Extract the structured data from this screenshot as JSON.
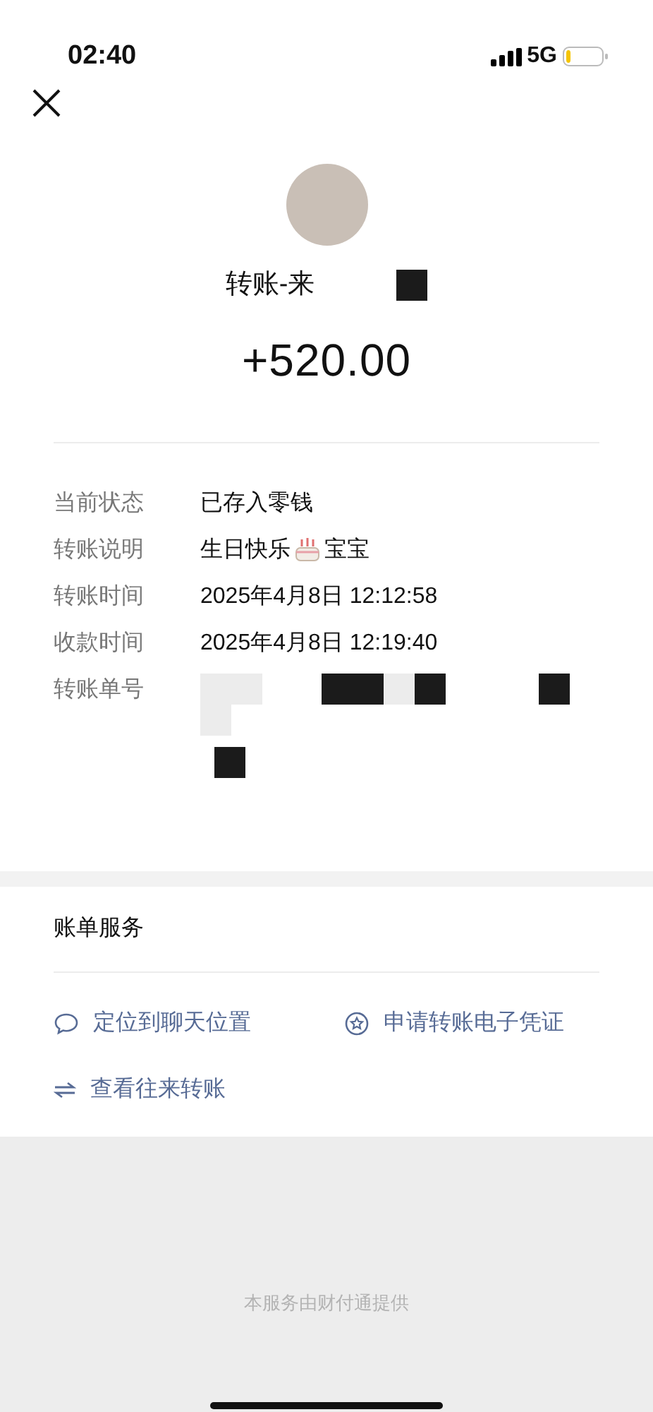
{
  "status_bar": {
    "time": "02:40",
    "network": "5G"
  },
  "header": {
    "title": "转账-来",
    "amount": "+520.00"
  },
  "details": [
    {
      "kind": "text",
      "label": "当前状态",
      "value": "已存入零钱"
    },
    {
      "kind": "emoji",
      "label": "转账说明",
      "value": "生日快乐",
      "value_after_icon": "宝宝"
    },
    {
      "kind": "text",
      "label": "转账时间",
      "value": "2025年4月8日 12:12:58"
    },
    {
      "kind": "text",
      "label": "收款时间",
      "value": "2025年4月8日 12:19:40"
    },
    {
      "kind": "redacted",
      "label": "转账单号"
    }
  ],
  "services": {
    "title": "账单服务",
    "links": [
      {
        "kind": "chat",
        "label": "定位到聊天位置"
      },
      {
        "kind": "voucher",
        "label": "申请转账电子凭证"
      },
      {
        "kind": "history",
        "label": "查看往来转账"
      }
    ]
  },
  "footer": "本服务由财付通提供"
}
